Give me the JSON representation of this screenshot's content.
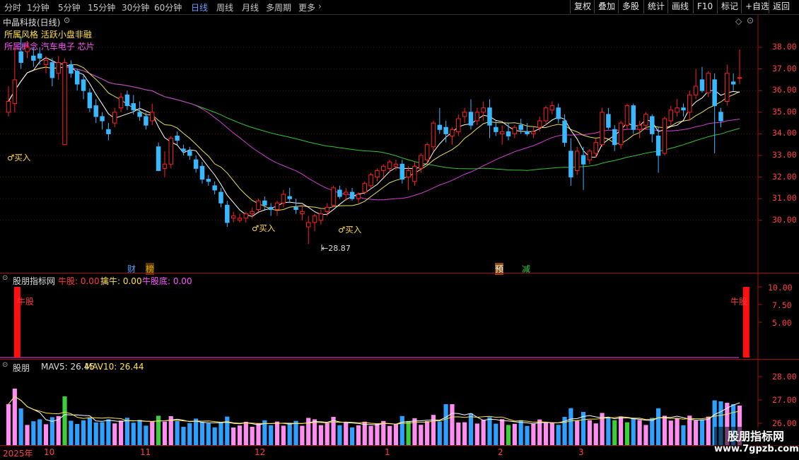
{
  "toolbar": {
    "periods": [
      "分时",
      "1分钟",
      "5分钟",
      "15分钟",
      "30分钟",
      "60分钟",
      "日线",
      "周线",
      "月线",
      "多周期",
      "更多"
    ],
    "active_period": "日线",
    "right_buttons": [
      "复权",
      "叠加",
      "多股",
      "统计",
      "画线",
      "F10",
      "标记",
      "+自选",
      "返回"
    ]
  },
  "main": {
    "title": "中晶科技(日线)",
    "concept_line1": "所属风格 活跃小盘非融",
    "concept_line2": "所属概念 汽车电子 芯片",
    "buy_label": "♂买入",
    "low_marker": "28.87",
    "events": [
      "财",
      "榜",
      "预",
      "减"
    ],
    "price_ticks": [
      "38.00",
      "37.00",
      "36.00",
      "35.00",
      "34.00",
      "33.00",
      "32.00",
      "31.00",
      "30.00"
    ]
  },
  "indicator": {
    "name": "股朋指标网",
    "v1": "牛股: 0.00",
    "v2": "擒牛: 0.00",
    "v3": "牛股底: 0.00",
    "signal": "牛股",
    "ticks": [
      "10.00",
      "7.50",
      "5.00"
    ]
  },
  "volume": {
    "name": "股朋",
    "mav5": "MAV5: 26.45",
    "mav10": "MAV10: 26.44",
    "ticks": [
      "28.00",
      "27.00",
      "26.00"
    ]
  },
  "xaxis": {
    "labels": [
      "2025年",
      "10",
      "11",
      "12",
      "1",
      "2",
      "3"
    ]
  },
  "watermark": {
    "line1": "股朋指标网",
    "line2": "www.7gpzb.com"
  },
  "chart_data": {
    "type": "candlestick",
    "title": "中晶科技(日线)",
    "ylim": [
      28.5,
      38.5
    ],
    "ohlc": [
      [
        35.0,
        36.2,
        34.8,
        35.5
      ],
      [
        35.4,
        38.0,
        35.0,
        36.5
      ],
      [
        37.8,
        38.5,
        37.0,
        37.3
      ],
      [
        37.8,
        38.3,
        37.5,
        38.0
      ],
      [
        37.6,
        38.0,
        37.1,
        37.4
      ],
      [
        37.7,
        38.0,
        37.2,
        37.5
      ],
      [
        37.2,
        37.6,
        36.8,
        37.4
      ],
      [
        37.3,
        37.5,
        36.2,
        36.6
      ],
      [
        36.8,
        37.6,
        36.5,
        37.3
      ],
      [
        33.5,
        37.5,
        33.5,
        37.3
      ],
      [
        37.2,
        37.4,
        36.6,
        36.8
      ],
      [
        36.9,
        37.0,
        36.0,
        36.3
      ],
      [
        36.5,
        36.7,
        35.6,
        36.0
      ],
      [
        35.9,
        36.1,
        35.0,
        35.2
      ],
      [
        35.3,
        35.6,
        34.5,
        34.8
      ],
      [
        34.8,
        35.0,
        34.2,
        34.6
      ],
      [
        34.2,
        34.5,
        33.7,
        34.0
      ],
      [
        34.5,
        35.2,
        34.3,
        35.0
      ],
      [
        35.2,
        35.9,
        35.0,
        35.7
      ],
      [
        35.8,
        36.0,
        35.1,
        35.3
      ],
      [
        35.4,
        35.8,
        34.9,
        35.1
      ],
      [
        35.0,
        35.5,
        34.6,
        34.8
      ],
      [
        34.8,
        35.0,
        34.2,
        34.4
      ],
      [
        34.6,
        35.4,
        34.4,
        35.0
      ],
      [
        33.4,
        33.6,
        32.3,
        32.3
      ],
      [
        32.4,
        33.2,
        32.0,
        32.6
      ],
      [
        32.6,
        33.9,
        32.4,
        33.8
      ],
      [
        33.9,
        34.1,
        33.5,
        33.7
      ],
      [
        33.3,
        33.5,
        33.0,
        33.2
      ],
      [
        33.2,
        33.4,
        32.8,
        33.0
      ],
      [
        32.8,
        33.0,
        32.2,
        32.4
      ],
      [
        32.5,
        32.7,
        31.7,
        31.9
      ],
      [
        31.9,
        32.1,
        31.6,
        31.8
      ],
      [
        31.6,
        31.8,
        31.2,
        31.4
      ],
      [
        31.3,
        31.5,
        30.6,
        30.8
      ],
      [
        30.7,
        30.9,
        29.7,
        29.9
      ],
      [
        30.1,
        30.4,
        29.9,
        30.2
      ],
      [
        30.0,
        30.3,
        29.9,
        30.1
      ],
      [
        30.1,
        30.4,
        29.9,
        30.3
      ],
      [
        30.3,
        30.6,
        30.1,
        30.4
      ],
      [
        30.5,
        31.0,
        30.4,
        30.9
      ],
      [
        30.9,
        31.1,
        30.5,
        30.7
      ],
      [
        30.6,
        30.8,
        30.2,
        30.5
      ],
      [
        30.5,
        30.9,
        30.2,
        30.8
      ],
      [
        30.8,
        31.4,
        30.6,
        31.2
      ],
      [
        31.1,
        31.5,
        30.8,
        31.0
      ],
      [
        30.6,
        31.0,
        30.3,
        30.5
      ],
      [
        30.3,
        30.7,
        30.0,
        30.4
      ],
      [
        29.7,
        30.2,
        28.9,
        29.9
      ],
      [
        29.9,
        30.3,
        29.5,
        30.2
      ],
      [
        30.0,
        30.5,
        29.8,
        30.3
      ],
      [
        30.4,
        30.8,
        30.2,
        30.6
      ],
      [
        30.7,
        31.6,
        30.6,
        31.5
      ],
      [
        31.4,
        31.6,
        31.0,
        31.1
      ],
      [
        31.2,
        31.5,
        30.9,
        31.3
      ],
      [
        31.3,
        31.5,
        30.9,
        31.0
      ],
      [
        31.0,
        31.3,
        30.8,
        31.2
      ],
      [
        31.3,
        31.8,
        31.2,
        31.7
      ],
      [
        31.6,
        32.2,
        31.5,
        32.1
      ],
      [
        32.0,
        32.4,
        31.8,
        32.3
      ],
      [
        32.3,
        32.6,
        32.0,
        32.5
      ],
      [
        32.4,
        32.8,
        32.2,
        32.7
      ],
      [
        32.5,
        32.8,
        32.3,
        32.6
      ],
      [
        32.6,
        32.8,
        31.7,
        31.9
      ],
      [
        32.0,
        32.5,
        31.4,
        32.3
      ],
      [
        31.8,
        32.7,
        31.6,
        32.5
      ],
      [
        32.4,
        33.1,
        32.2,
        33.0
      ],
      [
        32.8,
        33.6,
        32.6,
        33.5
      ],
      [
        33.4,
        34.6,
        33.2,
        34.5
      ],
      [
        34.4,
        35.2,
        34.0,
        34.2
      ],
      [
        34.3,
        34.6,
        33.6,
        34.0
      ],
      [
        33.9,
        34.3,
        33.5,
        34.2
      ],
      [
        34.1,
        34.9,
        33.9,
        34.7
      ],
      [
        34.8,
        35.2,
        34.5,
        35.0
      ],
      [
        35.0,
        35.6,
        34.2,
        34.4
      ],
      [
        34.6,
        35.2,
        34.4,
        35.0
      ],
      [
        35.0,
        35.5,
        34.6,
        35.2
      ],
      [
        35.2,
        35.6,
        33.8,
        34.4
      ],
      [
        34.3,
        34.6,
        33.9,
        34.1
      ],
      [
        34.0,
        34.4,
        33.5,
        34.1
      ],
      [
        34.1,
        34.5,
        33.7,
        33.9
      ],
      [
        34.0,
        34.4,
        33.8,
        34.3
      ],
      [
        34.4,
        34.7,
        34.0,
        34.2
      ],
      [
        34.1,
        34.5,
        33.9,
        34.0
      ],
      [
        34.0,
        34.3,
        33.8,
        34.1
      ],
      [
        34.3,
        34.8,
        34.1,
        34.6
      ],
      [
        34.6,
        35.3,
        34.4,
        35.2
      ],
      [
        35.1,
        35.5,
        34.9,
        35.3
      ],
      [
        35.2,
        35.4,
        34.5,
        34.7
      ],
      [
        34.6,
        34.9,
        33.4,
        33.6
      ],
      [
        33.2,
        33.8,
        31.6,
        32.0
      ],
      [
        32.3,
        33.4,
        32.1,
        33.2
      ],
      [
        33.0,
        33.4,
        31.4,
        32.6
      ],
      [
        32.8,
        33.3,
        32.6,
        33.2
      ],
      [
        33.1,
        33.8,
        32.9,
        33.6
      ],
      [
        33.5,
        35.2,
        33.4,
        35.0
      ],
      [
        34.9,
        35.2,
        34.2,
        34.3
      ],
      [
        34.2,
        34.4,
        33.2,
        33.5
      ],
      [
        33.5,
        34.6,
        33.3,
        34.5
      ],
      [
        34.4,
        35.4,
        34.2,
        35.3
      ],
      [
        35.3,
        35.4,
        34.0,
        34.2
      ],
      [
        34.2,
        34.6,
        33.8,
        34.4
      ],
      [
        34.4,
        35.0,
        34.2,
        34.9
      ],
      [
        34.8,
        34.9,
        33.6,
        34.0
      ],
      [
        33.9,
        34.3,
        32.2,
        33.0
      ],
      [
        33.1,
        34.8,
        33.0,
        34.7
      ],
      [
        34.6,
        35.3,
        34.4,
        35.1
      ],
      [
        35.0,
        35.6,
        34.8,
        35.2
      ],
      [
        35.2,
        35.4,
        34.8,
        35.1
      ],
      [
        35.0,
        36.0,
        34.6,
        35.8
      ],
      [
        35.8,
        37.0,
        35.6,
        36.2
      ],
      [
        36.5,
        37.1,
        35.9,
        36.0
      ],
      [
        35.9,
        36.9,
        35.7,
        36.8
      ],
      [
        36.5,
        36.8,
        33.1,
        35.3
      ],
      [
        35.0,
        35.2,
        34.3,
        34.6
      ],
      [
        35.5,
        37.2,
        35.3,
        36.8
      ],
      [
        36.4,
        36.8,
        36.0,
        36.3
      ],
      [
        36.6,
        37.9,
        36.3,
        36.6
      ]
    ],
    "indicator_signals": [
      1,
      118
    ],
    "volume_ticks": [
      "28.00",
      "27.00",
      "26.00"
    ]
  }
}
